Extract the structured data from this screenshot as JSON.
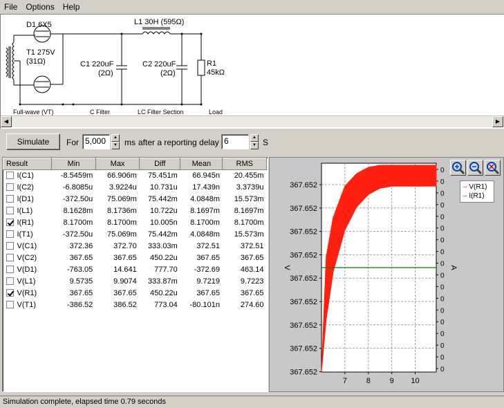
{
  "menu": {
    "file": "File",
    "options": "Options",
    "help": "Help"
  },
  "schematic": {
    "d1": "D1 6X5",
    "t1_a": "T1 275V",
    "t1_b": "(31Ω)",
    "l1": "L1 30H (595Ω)",
    "c1_a": "C1 220uF",
    "c1_b": "(2Ω)",
    "c2_a": "C2 220uF",
    "c2_b": "(2Ω)",
    "r1_a": "R1",
    "r1_b": "45kΩ",
    "sec_rect": "Full-wave (VT)",
    "sec_c": "C Filter",
    "sec_lc": "LC Filter Section",
    "sec_load": "Load"
  },
  "toolbar": {
    "simulate": "Simulate",
    "for": "For",
    "duration": "5,000",
    "ms": "ms",
    "after": "after a reporting delay of",
    "delay": "6",
    "s": "S"
  },
  "table": {
    "headers": [
      "Result",
      "Min",
      "Max",
      "Diff",
      "Mean",
      "RMS"
    ],
    "rows": [
      {
        "name": "I(C1)",
        "checked": false,
        "min": "-8.5459m",
        "max": "66.906m",
        "diff": "75.451m",
        "mean": "66.945n",
        "rms": "20.455m"
      },
      {
        "name": "I(C2)",
        "checked": false,
        "min": "-6.8085u",
        "max": "3.9224u",
        "diff": "10.731u",
        "mean": "17.439n",
        "rms": "3.3739u"
      },
      {
        "name": "I(D1)",
        "checked": false,
        "min": "-372.50u",
        "max": "75.069m",
        "diff": "75.442m",
        "mean": "4.0848m",
        "rms": "15.573m"
      },
      {
        "name": "I(L1)",
        "checked": false,
        "min": "8.1628m",
        "max": "8.1736m",
        "diff": "10.722u",
        "mean": "8.1697m",
        "rms": "8.1697m"
      },
      {
        "name": "I(R1)",
        "checked": true,
        "min": "8.1700m",
        "max": "8.1700m",
        "diff": "10.005n",
        "mean": "8.1700m",
        "rms": "8.1700m"
      },
      {
        "name": "I(T1)",
        "checked": false,
        "min": "-372.50u",
        "max": "75.069m",
        "diff": "75.442m",
        "mean": "4.0848m",
        "rms": "15.573m"
      },
      {
        "name": "V(C1)",
        "checked": false,
        "min": "372.36",
        "max": "372.70",
        "diff": "333.03m",
        "mean": "372.51",
        "rms": "372.51"
      },
      {
        "name": "V(C2)",
        "checked": false,
        "min": "367.65",
        "max": "367.65",
        "diff": "450.22u",
        "mean": "367.65",
        "rms": "367.65"
      },
      {
        "name": "V(D1)",
        "checked": false,
        "min": "-763.05",
        "max": "14.641",
        "diff": "777.70",
        "mean": "-372.69",
        "rms": "463.14"
      },
      {
        "name": "V(L1)",
        "checked": false,
        "min": "9.5735",
        "max": "9.9074",
        "diff": "333.87m",
        "mean": "9.7219",
        "rms": "9.7223"
      },
      {
        "name": "V(R1)",
        "checked": true,
        "min": "367.65",
        "max": "367.65",
        "diff": "450.22u",
        "mean": "367.65",
        "rms": "367.65"
      },
      {
        "name": "V(T1)",
        "checked": false,
        "min": "-386.52",
        "max": "386.52",
        "diff": "773.04",
        "mean": "-80.101n",
        "rms": "274.60"
      }
    ]
  },
  "chart_data": {
    "type": "line",
    "xlabel": "",
    "ylabel": "V",
    "y2label": "A",
    "xlim": [
      6,
      10.9
    ],
    "x_ticks": [
      "7",
      "8",
      "9",
      "10"
    ],
    "y_ticks": [
      "367.652",
      "367.652",
      "367.652",
      "367.652",
      "367.652",
      "367.652",
      "367.652",
      "367.652",
      "367.652"
    ],
    "y2_ticks": [
      "0",
      "0",
      "0",
      "0",
      "0",
      "0",
      "0",
      "0",
      "0",
      "0",
      "0",
      "0",
      "0",
      "0",
      "0",
      "0",
      "0",
      "0"
    ],
    "grid": true,
    "legend_position": "top-right",
    "series": [
      {
        "name": "V(R1)",
        "color": "#ff2010",
        "shape": "envelope",
        "x": [
          6.0,
          6.2,
          6.5,
          7.0,
          7.5,
          8.0,
          8.5,
          9.0,
          9.5,
          10.0,
          10.9
        ],
        "upper": [
          0.0,
          0.55,
          0.74,
          0.89,
          0.95,
          0.98,
          0.99,
          0.99,
          0.99,
          0.99,
          0.99
        ],
        "lower": [
          0.0,
          0.25,
          0.48,
          0.68,
          0.79,
          0.85,
          0.88,
          0.89,
          0.89,
          0.89,
          0.89
        ]
      },
      {
        "name": "I(R1)",
        "color": "#008000",
        "shape": "flat",
        "level": 0.5
      }
    ]
  },
  "status": {
    "text": "Simulation complete, elapsed time 0.79 seconds"
  }
}
